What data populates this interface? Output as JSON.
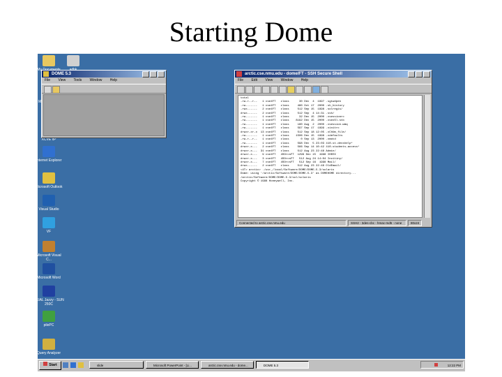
{
  "slide": {
    "title": "Starting Dome"
  },
  "desktop_icons": [
    {
      "label": "My Documents",
      "icon": "folder-icon",
      "color": "#e8c860"
    },
    {
      "label": "adbk",
      "icon": "document-icon",
      "color": "#d0d0d0"
    },
    {
      "label": "My Computer",
      "icon": "computer-icon",
      "color": "#c0c0c0"
    },
    {
      "label": "Network",
      "icon": "network-icon",
      "color": "#9ab"
    },
    {
      "label": "XCVE xP",
      "icon": "app-icon",
      "color": "#d04040"
    },
    {
      "label": "Internet Explorer",
      "icon": "browser-icon",
      "color": "#3070d0"
    },
    {
      "label": "Microsoft Outlook",
      "icon": "mail-icon",
      "color": "#e0c040"
    },
    {
      "label": "Visual Studio",
      "icon": "dev-icon",
      "color": "#2060b0"
    },
    {
      "label": "VF",
      "icon": "shortcut-icon",
      "color": "#30a0e0"
    },
    {
      "label": "Microsoft Visual C...",
      "icon": "compiler-icon",
      "color": "#c08030"
    },
    {
      "label": "Microsoft Word",
      "icon": "word-icon",
      "color": "#2050a0"
    },
    {
      "label": "NEIAL Jazzy - SUN 250C",
      "icon": "server-icon",
      "color": "#2040a0"
    },
    {
      "label": "pilePC",
      "icon": "pc-icon",
      "color": "#40a040"
    },
    {
      "label": "Query Analyzer",
      "icon": "query-icon",
      "color": "#d0b040"
    }
  ],
  "dome_window": {
    "title": "DOME 5.3",
    "menus": [
      "File",
      "View",
      "Tools",
      "Window",
      "Help"
    ]
  },
  "ssh_window": {
    "title": "arctic.cse.nmu.edu - dome/FT - SSH Secure Shell",
    "menus": [
      "File",
      "Edit",
      "View",
      "Window",
      "Help"
    ],
    "terminal_lines": [
      "total",
      "-rw-r--r--   1 cse4FT   class      30 Dec  4  1997 .sgtwdpen",
      "-rw-------   1 cse4FT   class     480 Oct 17  2000 .sh_history",
      "-rwx------   2 cse4FT   class     512 Sep 15  1998 .solregis/",
      "drwx------   2 cse4FT   class     512 Sep  4 14:31 .ssh/",
      "-rw-------   1 cse4FT   class      32 Dec 15  2000 .xsessionrc",
      "-rw-------   1 cse4FT   class    8192 Dec 15  2000 .xsexSl.stb",
      "-rw-------   1 cse4FT   class     180 Aug  2  2000 .xsession.wmq",
      "-rw-------   1 cse4FT   class     597 Sep 17  1999 .xinitrc",
      "drwxr-xr-x  13 cse4FT   class     512 Sep 18 12:05 .xChUm_file/",
      "-rw-------   1 cse4FT   class    1506 Dec 15  1998 .xdefaults",
      "-rw-r--r--   1 cse4FT   class       0 Sep 13  2000 .xmotd",
      "-rw-------   1 cse4FT   class     598 Dec  5 23:03 410-st.devshelp*",
      "drwxr-x---   2 cse4FT   class     566 Sep 14 10:42 410-students-access*",
      "drwxr-x---  31 cse4FT   class     512 Aug 23 22:48 Admin/",
      "drwxr-x---   9 cse4FT   4SOrcsFT  1299 Dec 15  1998 IHEEX",
      "drwxr-x---   3 cse4FT   4SOrcsFT   512 Aug 24 14:04 Invitiny/",
      "drwxr-x---   7 cse4FT   4SOrcsFT   512 Sep 16  1998 Mail/",
      "drwx------   2 cse4FT   class     512 Aug 23 22:48 OldEmail/",
      "<4T> arctic> ./usr_/local/Software/DOME/DOME-5.3/solaris",
      "Dome: using '/arctic/Software/DOME/DOME-5.3' as DOMEHOME directory...",
      "/arctic/Software/DOME/DOME-5.3/sol/solaris",
      "Copyright © 1998 Honeywell, Inc."
    ],
    "status_text": "Connected to arctic.cse.nmu.edu",
    "status_cipher": "SSH2 - 3des-cbc - hmac-md5 - none",
    "status_size": "80x24"
  },
  "taskbar": {
    "start_label": "Start",
    "buttons": [
      {
        "label": "slide"
      },
      {
        "label": "Microsoft PowerPoint - [Li..."
      },
      {
        "label": "arctic.cse.nmu.edu - dome..."
      },
      {
        "label": "DOME 5.3",
        "active": true
      }
    ],
    "clock": "12:22 PM"
  }
}
